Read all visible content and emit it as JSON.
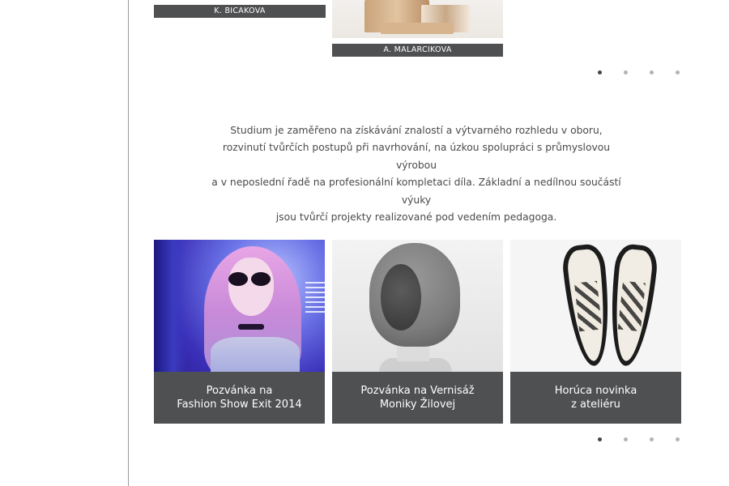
{
  "gallery": {
    "labels": [
      "K. BICAKOVA",
      "A. MALARCIKOVA"
    ]
  },
  "intro": {
    "lines": [
      "Studium je zaměřeno na získávání znalostí a výtvarného rozhledu v oboru,",
      "rozvinutí tvůrčích postupů při navrhování, na úzkou spolupráci s průmyslovou výrobou",
      "a v neposlední řadě na profesionální kompletaci díla. Základní a nedílnou součástí výuky",
      "jsou tvůrčí projekty realizované pod vedením pedagoga."
    ]
  },
  "news": [
    {
      "line1": "Pozvánka na",
      "line2": "Fashion Show Exit 2014"
    },
    {
      "line1": "Pozvánka na Vernisáž",
      "line2": "Moniky Žilovej"
    },
    {
      "line1": "Horúca novinka",
      "line2": "z ateliéru"
    }
  ],
  "pager_top": {
    "count": 4,
    "active_index": 0
  },
  "pager_bottom": {
    "count": 4,
    "active_index": 0
  },
  "colors": {
    "caption_bg": "#4f5052",
    "dot_active": "#444444",
    "dot_inactive": "#b3b3b3",
    "divider": "#9a9a9a"
  }
}
